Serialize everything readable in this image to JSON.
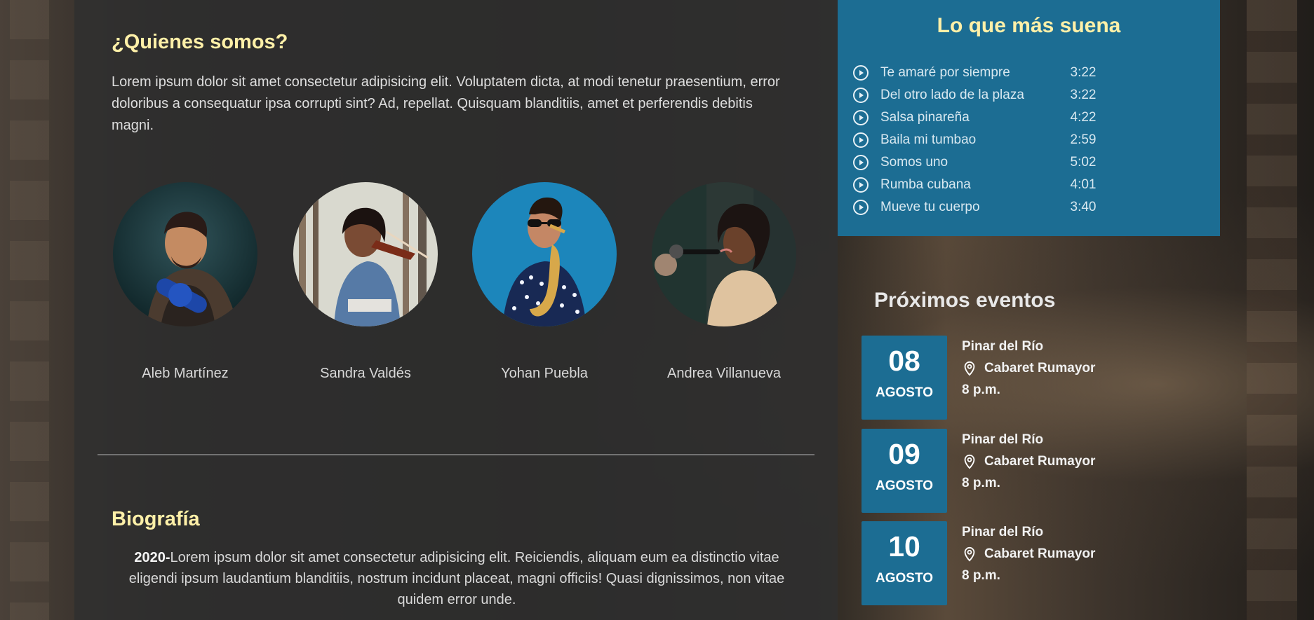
{
  "about": {
    "title": "¿Quienes somos?",
    "text": "Lorem ipsum dolor sit amet consectetur adipisicing elit. Voluptatem dicta, at modi tenetur praesentium, error doloribus a consequatur ipsa corrupti sint? Ad, repellat. Quisquam blanditiis, amet et perferendis debitis magni."
  },
  "members": [
    {
      "name": "Aleb Martínez",
      "icon": "guitarist-avatar"
    },
    {
      "name": "Sandra Valdés",
      "icon": "violinist-avatar"
    },
    {
      "name": "Yohan Puebla",
      "icon": "saxophonist-avatar"
    },
    {
      "name": "Andrea Villanueva",
      "icon": "singer-avatar"
    }
  ],
  "biography": {
    "title": "Biografía",
    "year": "2020-",
    "text": "Lorem ipsum dolor sit amet consectetur adipisicing elit. Reiciendis, aliquam eum ea distinctio vitae eligendi ipsum laudantium blanditiis, nostrum incidunt placeat, magni officiis! Quasi dignissimos, non vitae quidem error unde."
  },
  "tracks": {
    "title": "Lo que más suena",
    "items": [
      {
        "title": "Te amaré por siempre",
        "time": "3:22",
        "icon": "play-circle-icon"
      },
      {
        "title": "Del otro lado de la plaza",
        "time": "3:22",
        "icon": "play-circle-icon"
      },
      {
        "title": "Salsa pinareña",
        "time": "4:22",
        "icon": "play-circle-icon"
      },
      {
        "title": "Baila mi tumbao",
        "time": "2:59",
        "icon": "play-circle-icon"
      },
      {
        "title": "Somos uno",
        "time": "5:02",
        "icon": "play-circle-icon"
      },
      {
        "title": "Rumba cubana",
        "time": "4:01",
        "icon": "play-circle-icon"
      },
      {
        "title": "Mueve tu cuerpo",
        "time": "3:40",
        "icon": "play-circle-icon"
      }
    ]
  },
  "events": {
    "title": "Próximos eventos",
    "items": [
      {
        "day": "08",
        "month": "AGOSTO",
        "city": "Pinar del Río",
        "venue": "Cabaret Rumayor",
        "time": "8 p.m.",
        "icon": "location-pin-icon"
      },
      {
        "day": "09",
        "month": "AGOSTO",
        "city": "Pinar del Río",
        "venue": "Cabaret Rumayor",
        "time": "8 p.m.",
        "icon": "location-pin-icon"
      },
      {
        "day": "10",
        "month": "AGOSTO",
        "city": "Pinar del Río",
        "venue": "Cabaret Rumayor",
        "time": "8 p.m.",
        "icon": "location-pin-icon"
      }
    ]
  },
  "colors": {
    "accent_blue": "#1C6D93",
    "title_yellow": "#FFF0A8",
    "panel_dark": "#303030",
    "text_light": "#DEDEDE"
  }
}
